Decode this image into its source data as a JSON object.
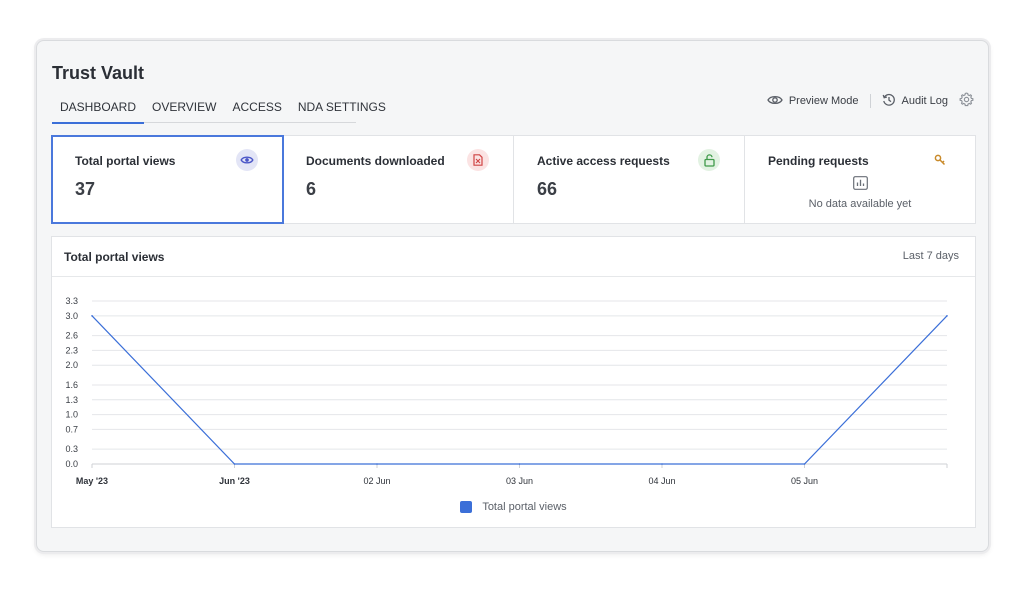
{
  "app": {
    "title": "Trust Vault"
  },
  "tabs": [
    {
      "label": "DASHBOARD",
      "active": true
    },
    {
      "label": "OVERVIEW",
      "active": false
    },
    {
      "label": "ACCESS",
      "active": false
    },
    {
      "label": "NDA SETTINGS",
      "active": false
    }
  ],
  "actions": {
    "preview_label": "Preview Mode",
    "preview_icon": "eye-icon",
    "audit_label": "Audit Log",
    "audit_icon": "history-icon",
    "settings_icon": "gear-icon"
  },
  "stats": [
    {
      "label": "Total portal views",
      "value": "37",
      "icon": "eye-icon",
      "icon_color": "#4a55c7",
      "icon_bg": "#e3e5f6",
      "selected": true
    },
    {
      "label": "Documents downloaded",
      "value": "6",
      "icon": "file-download-icon",
      "icon_color": "#d04444",
      "icon_bg": "#fbe3e3",
      "selected": false
    },
    {
      "label": "Active access requests",
      "value": "66",
      "icon": "unlock-icon",
      "icon_color": "#3f9a4a",
      "icon_bg": "#e2f2e2",
      "selected": false
    },
    {
      "label": "Pending requests",
      "value": "",
      "icon": "key-icon",
      "icon_color": "#c98a2a",
      "icon_bg": "#ffffff",
      "selected": false,
      "empty_icon": "bar-chart-icon",
      "empty_text": "No data available yet"
    }
  ],
  "chart_panel": {
    "title": "Total portal views",
    "range_label": "Last 7 days"
  },
  "colors": {
    "accent": "#3b6fd8",
    "series": "#3b6fd8"
  },
  "chart_data": {
    "type": "line",
    "x": [
      "May '23",
      "Jun '23",
      "02 Jun",
      "03 Jun",
      "04 Jun",
      "05 Jun",
      ""
    ],
    "x_bold": [
      true,
      true,
      false,
      false,
      false,
      false,
      false
    ],
    "series": [
      {
        "name": "Total portal views",
        "values": [
          3,
          0,
          0,
          0,
          0,
          0,
          3
        ]
      }
    ],
    "yticks": [
      "0.0",
      "0.3",
      "0.7",
      "1.0",
      "1.3",
      "1.6",
      "2.0",
      "2.3",
      "2.6",
      "3.0",
      "3.3"
    ],
    "ylim": [
      0,
      3.3
    ],
    "grid": true,
    "legend": "bottom-center",
    "title": "Total portal views",
    "xlabel": "",
    "ylabel": ""
  }
}
